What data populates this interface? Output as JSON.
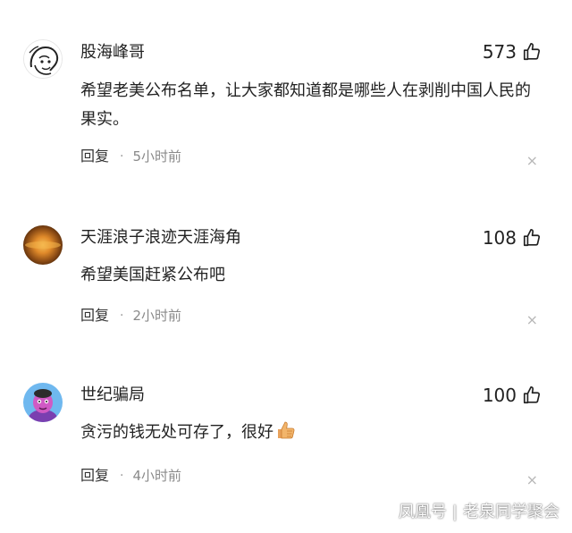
{
  "comments": [
    {
      "username": "股海峰哥",
      "likes": "573",
      "text": "希望老美公布名单，让大家都知道都是哪些人在剥削中国人民的果实。",
      "reply_label": "回复",
      "separator": "·",
      "time": "5小时前",
      "close": "×"
    },
    {
      "username": "天涯浪子浪迹天涯海角",
      "likes": "108",
      "text": "希望美国赶紧公布吧",
      "reply_label": "回复",
      "separator": "·",
      "time": "2小时前",
      "close": "×"
    },
    {
      "username": "世纪骗局",
      "likes": "100",
      "text": "贪污的钱无处可存了，很好",
      "reply_label": "回复",
      "separator": "·",
      "time": "4小时前",
      "close": "×"
    }
  ],
  "watermark": {
    "brand": "凤凰号",
    "separator": "|",
    "author": "老泉同学聚会"
  },
  "icons": {
    "like": "thumbs-up-outline-icon",
    "emoji": "thumbs-up-emoji-icon",
    "close": "close-icon"
  },
  "colors": {
    "text": "#222222",
    "meta": "#8a8a8a",
    "close": "#b8b8b8"
  }
}
